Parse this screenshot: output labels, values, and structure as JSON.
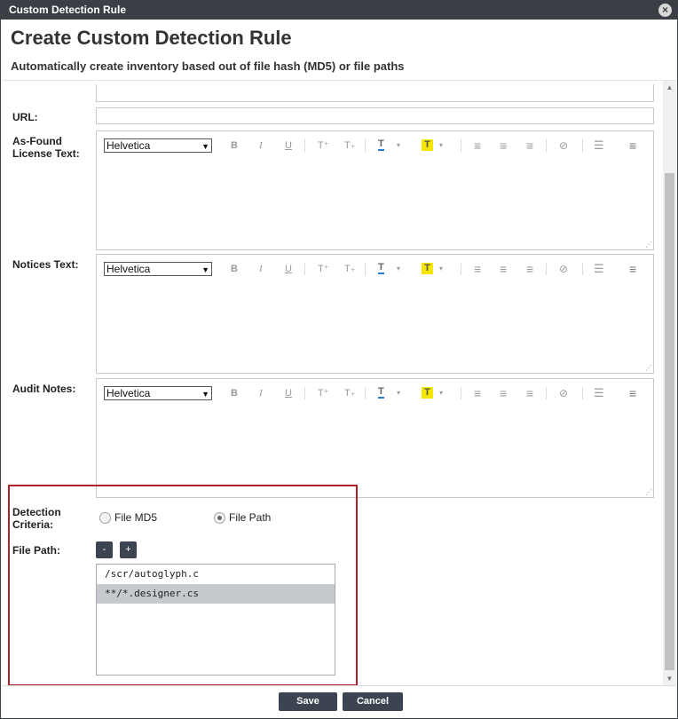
{
  "window": {
    "title": "Custom Detection Rule",
    "close_icon": "×"
  },
  "header": {
    "title": "Create Custom Detection Rule",
    "subtitle": "Automatically create inventory based out of file hash (MD5) or file paths"
  },
  "form": {
    "url_label": "URL:",
    "url_value": "",
    "editors": [
      {
        "label_line1": "As-Found",
        "label_line2": "License Text:",
        "font": "Helvetica"
      },
      {
        "label_line1": "Notices Text:",
        "label_line2": "",
        "font": "Helvetica"
      },
      {
        "label_line1": "Audit Notes:",
        "label_line2": "",
        "font": "Helvetica"
      }
    ],
    "toolbar": {
      "bold": "B",
      "italic": "I",
      "underline": "U",
      "superscript": "T⁺",
      "subscript": "T₊",
      "font_color": "T",
      "highlight": "T",
      "align_left": "≡",
      "align_center": "≡",
      "align_right": "≡",
      "link": "⊘",
      "list": "☰",
      "justify": "≡",
      "dropdown": "▾"
    },
    "detection": {
      "label_line1": "Detection",
      "label_line2": "Criteria:",
      "options": [
        {
          "label": "File MD5",
          "checked": false
        },
        {
          "label": "File Path",
          "checked": true
        }
      ]
    },
    "file_path": {
      "label": "File Path:",
      "remove_label": "-",
      "add_label": "+",
      "items": [
        {
          "value": "/scr/autoglyph.c",
          "selected": false
        },
        {
          "value": "**/*.designer.cs",
          "selected": true
        }
      ]
    }
  },
  "footer": {
    "save_label": "Save",
    "cancel_label": "Cancel"
  },
  "colors": {
    "titlebar": "#3b3f45",
    "button": "#3b4450",
    "highlight_box": "#b22027",
    "highlight_yellow": "#f5e600",
    "font_color_blue": "#2b7bd1"
  }
}
